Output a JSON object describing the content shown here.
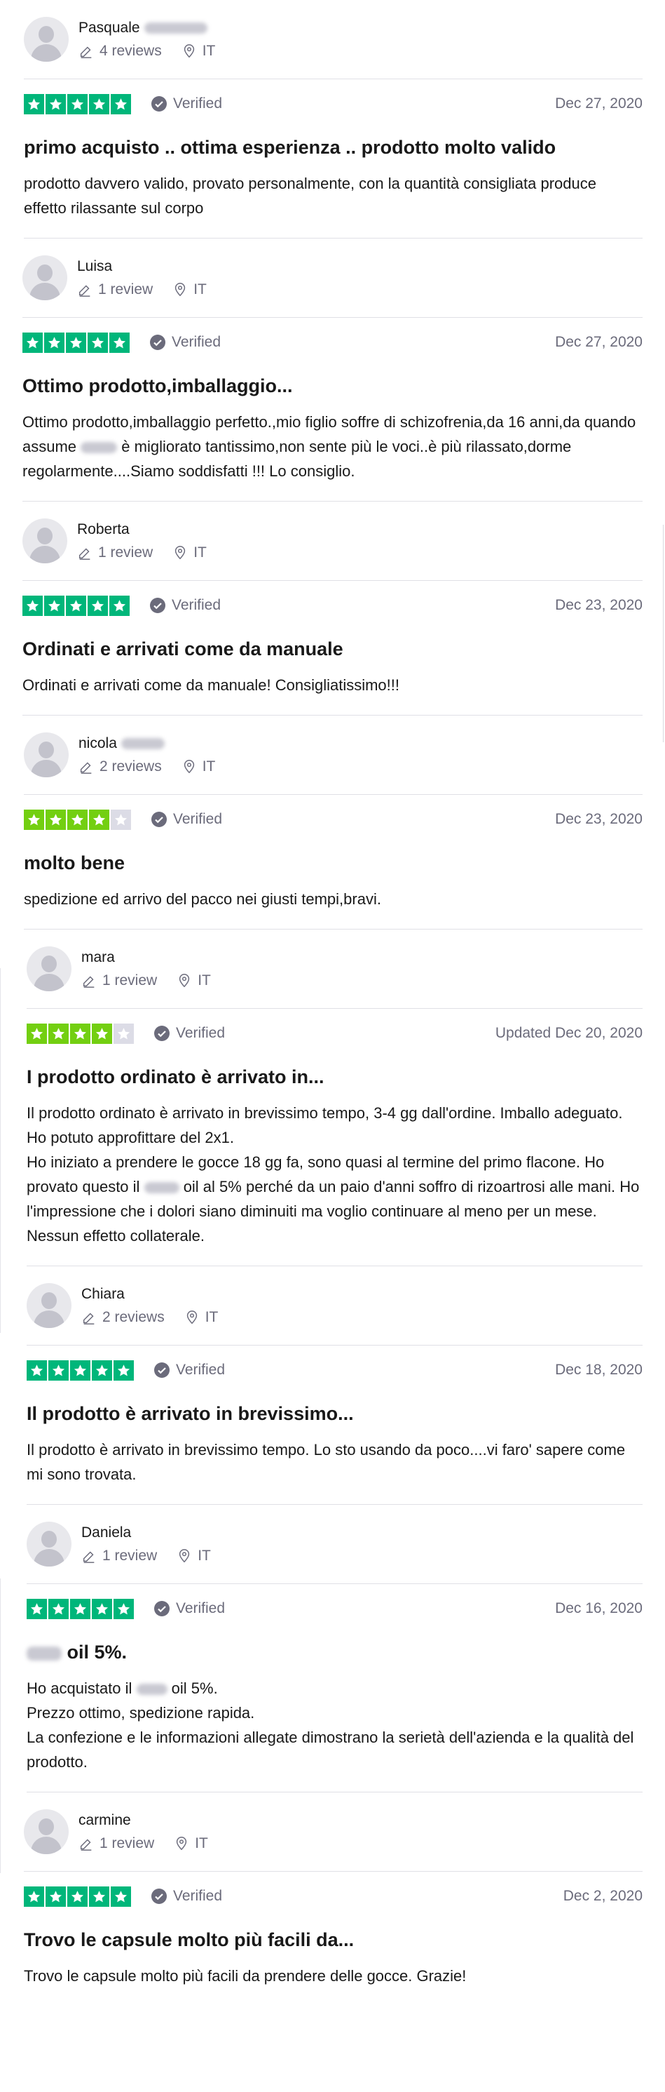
{
  "colors": {
    "green_5": "#00b67a",
    "green_4": "#73cf11",
    "empty_star": "#dcdce6",
    "verified_badge": "#6b6b7b"
  },
  "reviews": [
    {
      "name": "Pasquale",
      "reviews_count": "4 reviews",
      "country": "IT",
      "rating": 5,
      "verified": "Verified",
      "date": "Dec 27, 2020",
      "title": "primo acquisto .. ottima esperienza .. prodotto molto valido",
      "body": [
        "prodotto davvero valido, provato personalmente, con la quantità consigliata produce effetto rilassante sul corpo"
      ]
    },
    {
      "name": "Luisa",
      "reviews_count": "1 review",
      "country": "IT",
      "rating": 5,
      "verified": "Verified",
      "date": "Dec 27, 2020",
      "title": "Ottimo prodotto,imballaggio...",
      "body_a": "Ottimo prodotto,imballaggio perfetto.,mio figlio soffre di schizofrenia,da 16 anni,da quando assume",
      "body_b": "è migliorato tantissimo,non sente più le voci..è più rilassato,dorme regolarmente....Siamo soddisfatti !!! Lo consiglio."
    },
    {
      "name": "Roberta",
      "reviews_count": "1 review",
      "country": "IT",
      "rating": 5,
      "verified": "Verified",
      "date": "Dec 23, 2020",
      "title": "Ordinati e arrivati come da manuale",
      "body": [
        "Ordinati e arrivati come da manuale! Consigliatissimo!!!"
      ]
    },
    {
      "name": "nicola",
      "reviews_count": "2 reviews",
      "country": "IT",
      "rating": 4,
      "verified": "Verified",
      "date": "Dec 23, 2020",
      "title": "molto bene",
      "body": [
        "spedizione ed arrivo del pacco nei giusti tempi,bravi."
      ]
    },
    {
      "name": "mara",
      "reviews_count": "1 review",
      "country": "IT",
      "rating": 4,
      "verified": "Verified",
      "date": "Updated Dec 20, 2020",
      "title": "I prodotto ordinato è arrivato in...",
      "line1": "Il prodotto ordinato è arrivato in brevissimo tempo, 3-4 gg dall'ordine. Imballo adeguato. Ho potuto approfittare del 2x1.",
      "line2_a": "Ho iniziato a prendere le gocce 18 gg fa, sono quasi al termine del primo flacone. Ho provato questo il",
      "line2_b": "oil al 5% perché da un paio d'anni soffro di rizoartrosi alle mani. Ho l'impressione che i dolori siano diminuiti ma voglio continuare al meno per un mese. Nessun effetto collaterale."
    },
    {
      "name": "Chiara",
      "reviews_count": "2 reviews",
      "country": "IT",
      "rating": 5,
      "verified": "Verified",
      "date": "Dec 18, 2020",
      "title": "Il prodotto è arrivato in brevissimo...",
      "body": [
        "Il prodotto è arrivato in brevissimo tempo. Lo sto usando da poco....vi faro' sapere come mi sono trovata."
      ]
    },
    {
      "name": "Daniela",
      "reviews_count": "1 review",
      "country": "IT",
      "rating": 5,
      "verified": "Verified",
      "date": "Dec 16, 2020",
      "title_b": "oil 5%.",
      "line1_a": "Ho acquistato il",
      "line1_b": "oil 5%.",
      "line2": "Prezzo ottimo, spedizione rapida.",
      "line3": "La confezione e le informazioni allegate dimostrano la serietà dell'azienda e la qualità del prodotto."
    },
    {
      "name": "carmine",
      "reviews_count": "1 review",
      "country": "IT",
      "rating": 5,
      "verified": "Verified",
      "date": "Dec 2, 2020",
      "title": "Trovo le capsule molto più facili da...",
      "body": [
        "Trovo le capsule molto più facili da prendere delle gocce. Grazie!"
      ]
    }
  ]
}
